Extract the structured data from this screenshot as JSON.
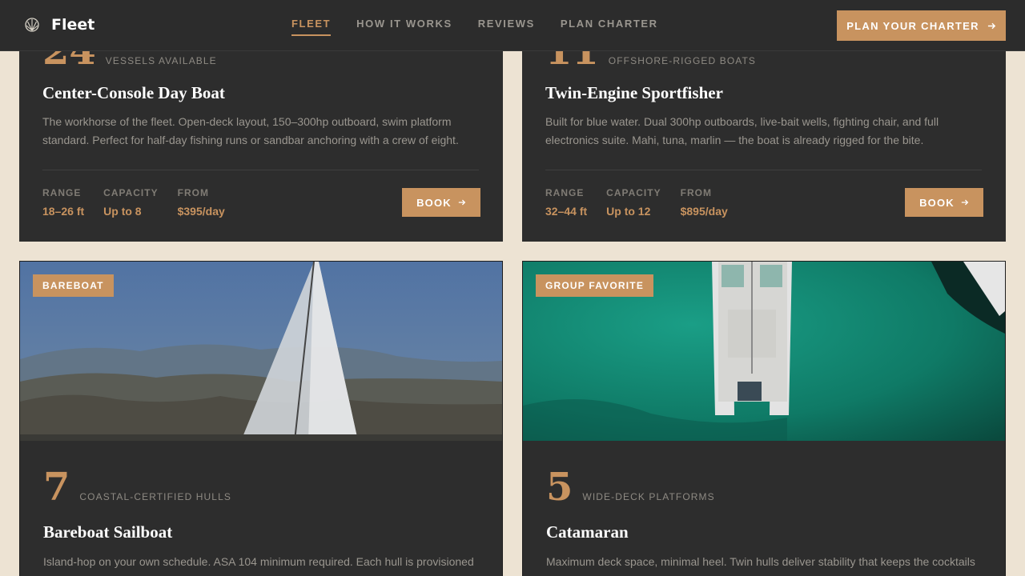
{
  "header": {
    "brand": "Fleet",
    "brand_icon": "shell-icon",
    "nav": [
      {
        "label": "FLEET",
        "active": true
      },
      {
        "label": "HOW IT WORKS",
        "active": false
      },
      {
        "label": "REVIEWS",
        "active": false
      },
      {
        "label": "PLAN CHARTER",
        "active": false
      }
    ],
    "cta_label": "PLAN YOUR CHARTER",
    "cta_icon": "arrow-right-icon"
  },
  "cards": [
    {
      "stat_number": "24",
      "stat_label": "VESSELS AVAILABLE",
      "title": "Center-Console Day Boat",
      "description": "The workhorse of the fleet. Open-deck layout, 150–300hp outboard, swim platform standard. Perfect for half-day fishing runs or sandbar anchoring with a crew of eight.",
      "specs": [
        {
          "label": "RANGE",
          "value": "18–26 ft"
        },
        {
          "label": "CAPACITY",
          "value": "Up to 8"
        },
        {
          "label": "FROM",
          "value": "$395/day"
        }
      ],
      "book_label": "BOOK"
    },
    {
      "stat_number": "11",
      "stat_label": "OFFSHORE-RIGGED BOATS",
      "title": "Twin-Engine Sportfisher",
      "description": "Built for blue water. Dual 300hp outboards, live-bait wells, fighting chair, and full electronics suite. Mahi, tuna, marlin — the boat is already rigged for the bite.",
      "specs": [
        {
          "label": "RANGE",
          "value": "32–44 ft"
        },
        {
          "label": "CAPACITY",
          "value": "Up to 12"
        },
        {
          "label": "FROM",
          "value": "$895/day"
        }
      ],
      "book_label": "BOOK"
    },
    {
      "badge": "BAREBOAT",
      "stat_number": "7",
      "stat_label": "COASTAL-CERTIFIED HULLS",
      "title": "Bareboat Sailboat",
      "description": "Island-hop on your own schedule. ASA 104 minimum required. Each hull is provisioned"
    },
    {
      "badge": "GROUP FAVORITE",
      "stat_number": "5",
      "stat_label": "WIDE-DECK PLATFORMS",
      "title": "Catamaran",
      "description": "Maximum deck space, minimal heel. Twin hulls deliver stability that keeps the cocktails"
    }
  ],
  "colors": {
    "accent": "#c8935f",
    "header_bg": "#2c2c2c",
    "card_bg": "#2d2d2d",
    "page_bg": "#ede3d3"
  }
}
